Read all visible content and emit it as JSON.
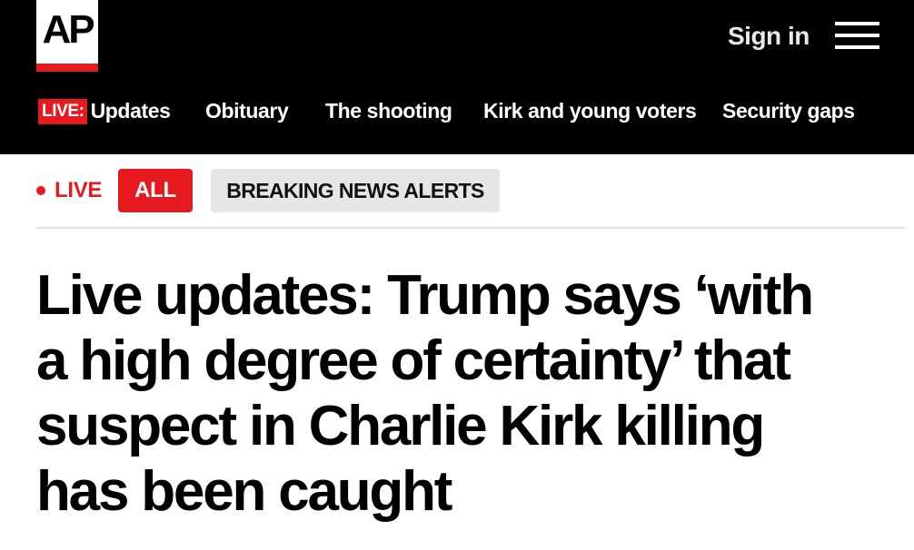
{
  "logo": {
    "text": "AP",
    "stripe_color": "#e5191e"
  },
  "header": {
    "signin_label": "Sign in",
    "menu_icon": "hamburger-menu-icon"
  },
  "nav": {
    "live_tag": "LIVE:",
    "items": [
      "Updates",
      "Obituary",
      "The shooting",
      "Kirk and young voters",
      "Security gaps"
    ]
  },
  "filters": {
    "live_label": "LIVE",
    "all_label": "ALL",
    "breaking_label": "BREAKING NEWS ALERTS",
    "active": "ALL"
  },
  "article": {
    "headline": "Live updates: Trump says ‘with a high degree of certainty’ that suspect in Charlie Kirk killing has been caught"
  },
  "colors": {
    "accent": "#e5191e",
    "header_bg": "#000000",
    "inactive_filter_bg": "#e6e6e6"
  }
}
